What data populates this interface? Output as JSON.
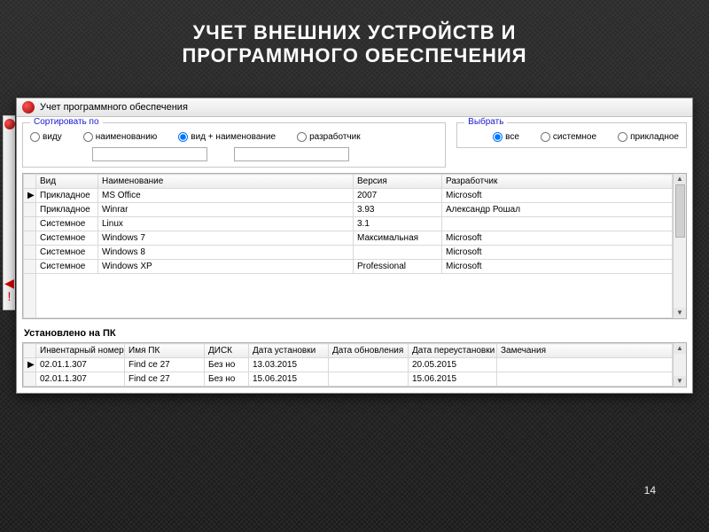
{
  "slide": {
    "title_line1": "УЧЕТ ВНЕШНИХ УСТРОЙСТВ И",
    "title_line2": "ПРОГРАММНОГО ОБЕСПЕЧЕНИЯ",
    "page_number": "14"
  },
  "window": {
    "title": "Учет программного обеспечения"
  },
  "sort": {
    "legend": "Сортировать по",
    "options": {
      "a": "виду",
      "b": "наименованию",
      "c": "вид + наименование",
      "d": "разработчик"
    },
    "selected": "c"
  },
  "select": {
    "legend": "Выбрать",
    "options": {
      "a": "все",
      "b": "системное",
      "c": "прикладное"
    },
    "selected": "a"
  },
  "search": {
    "field1": "",
    "field2": ""
  },
  "grid1": {
    "headers": {
      "kind": "Вид",
      "name": "Наименование",
      "version": "Версия",
      "developer": "Разработчик"
    },
    "rows": [
      {
        "marker": "▶",
        "kind": "Прикладное",
        "name": "MS Office",
        "version": "2007",
        "developer": "Microsoft"
      },
      {
        "marker": "",
        "kind": "Прикладное",
        "name": "Winrar",
        "version": "3.93",
        "developer": "Александр Рошал"
      },
      {
        "marker": "",
        "kind": "Системное",
        "name": "Linux",
        "version": "3.1",
        "developer": ""
      },
      {
        "marker": "",
        "kind": "Системное",
        "name": "Windows 7",
        "version": "Максимальная",
        "developer": "Microsoft"
      },
      {
        "marker": "",
        "kind": "Системное",
        "name": "Windows 8",
        "version": "",
        "developer": "Microsoft"
      },
      {
        "marker": "",
        "kind": "Системное",
        "name": "Windows XP",
        "version": "Professional",
        "developer": "Microsoft"
      }
    ]
  },
  "section2_title": "Установлено на ПК",
  "grid2": {
    "headers": {
      "inv": "Инвентарный номер",
      "pc": "Имя ПК",
      "disk": "ДИСК",
      "install": "Дата установки",
      "update": "Дата обновления",
      "reinstall": "Дата переустановки",
      "notes": "Замечания"
    },
    "rows": [
      {
        "marker": "▶",
        "inv": "02.01.1.307",
        "pc": "Find ce 27",
        "disk": "Без но",
        "install": "13.03.2015",
        "update": "",
        "reinstall": "20.05.2015",
        "notes": ""
      },
      {
        "marker": "",
        "inv": "02.01.1.307",
        "pc": "Find ce 27",
        "disk": "Без но",
        "install": "15.06.2015",
        "update": "",
        "reinstall": "15.06.2015",
        "notes": ""
      }
    ]
  }
}
